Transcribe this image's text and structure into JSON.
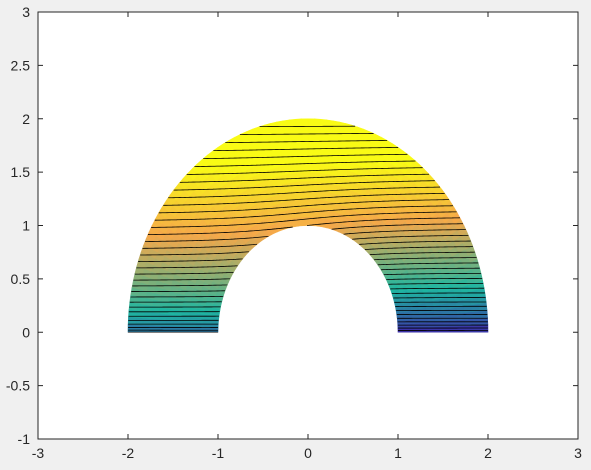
{
  "chart_data": {
    "type": "contour",
    "title": "",
    "xlabel": "",
    "ylabel": "",
    "xlim": [
      -3,
      3
    ],
    "ylim": [
      -1,
      3
    ],
    "xticks": [
      "-3",
      "-2",
      "-1",
      "0",
      "1",
      "2",
      "3"
    ],
    "yticks": [
      "-1",
      "-0.5",
      "0",
      "0.5",
      "1",
      "1.5",
      "2",
      "2.5",
      "3"
    ],
    "grid": false,
    "legend": "none",
    "region": {
      "shape": "half-annulus",
      "inner_radius": 1,
      "outer_radius": 2,
      "theta_range_deg": [
        0,
        180
      ]
    },
    "colormap": "parula",
    "contour_line_color": "#000000",
    "colors": {
      "low": "#3e26a8",
      "mid": "#1fb6a1",
      "high": "#f9fb15",
      "peak": "#f5a84a",
      "axes_background": "#ffffff",
      "figure_background": "#f0f0f0"
    }
  }
}
